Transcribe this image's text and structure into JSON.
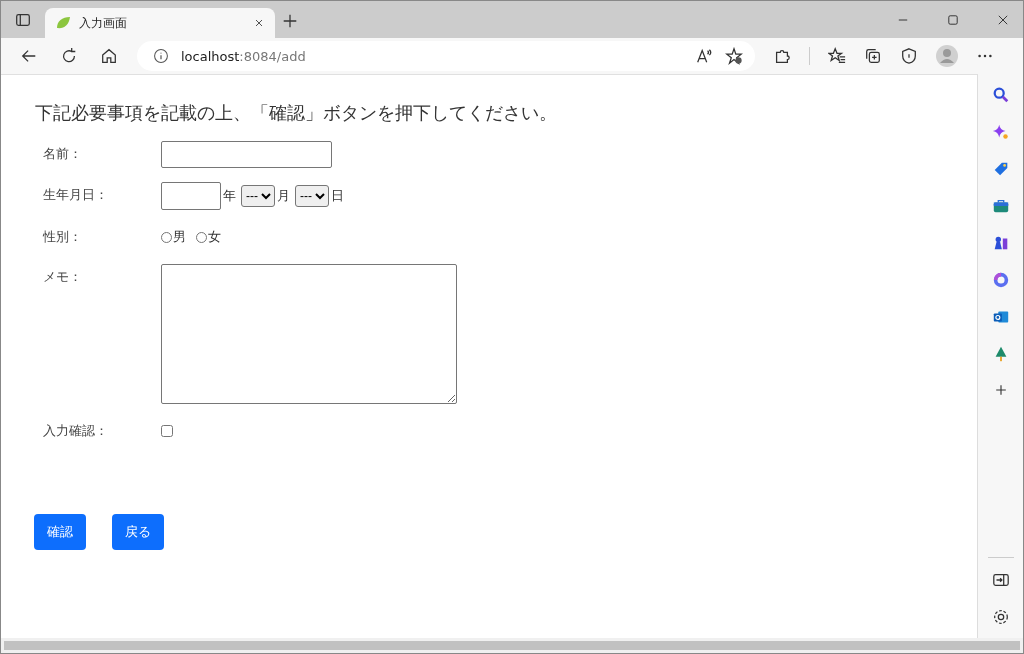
{
  "browser": {
    "tab": {
      "title": "入力画面"
    },
    "address": {
      "host": "localhost",
      "path": ":8084/add"
    }
  },
  "page": {
    "heading": "下記必要事項を記載の上、「確認」ボタンを押下してください。",
    "fields": [
      {
        "kind": "text",
        "label": "名前："
      },
      {
        "kind": "date",
        "label": "生年月日：",
        "year_unit": "年",
        "month": {
          "value": "---"
        },
        "month_unit": "月",
        "day": {
          "value": "---"
        },
        "day_unit": "日"
      },
      {
        "kind": "radio",
        "label": "性別：",
        "options": [
          {
            "label": "男",
            "selected": false
          },
          {
            "label": "女",
            "selected": false
          }
        ]
      },
      {
        "kind": "textarea",
        "label": "メモ："
      },
      {
        "kind": "checkbox",
        "label": "入力確認：",
        "checked": false
      }
    ],
    "buttons": [
      "確認",
      "戻る"
    ]
  }
}
